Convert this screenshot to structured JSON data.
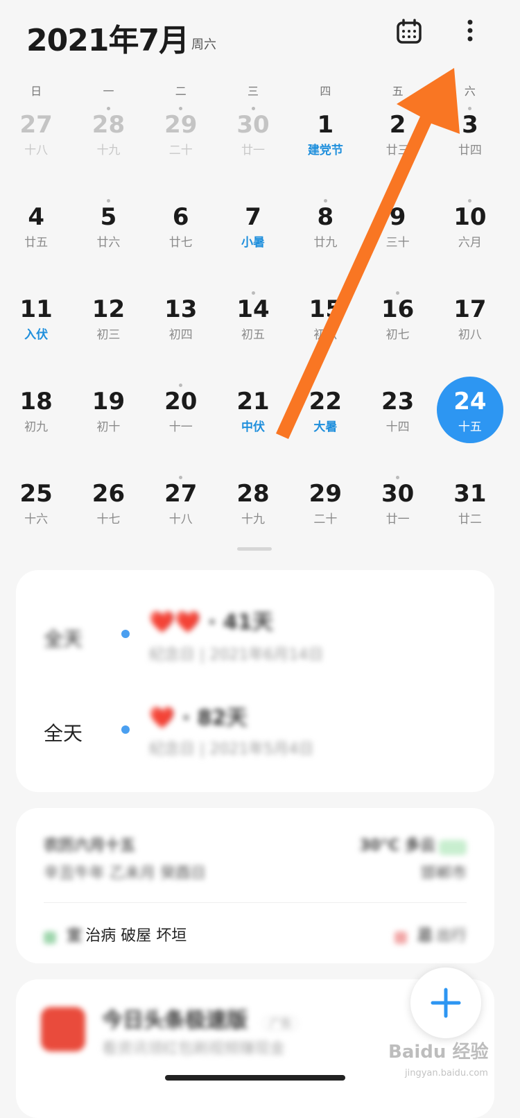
{
  "header": {
    "title": "2021年7月",
    "weekday": "周六"
  },
  "weekdays": [
    "日",
    "一",
    "二",
    "三",
    "四",
    "五",
    "六"
  ],
  "weeks": [
    [
      {
        "num": "27",
        "lunar": "十八",
        "other": true,
        "dot": false
      },
      {
        "num": "28",
        "lunar": "十九",
        "other": true,
        "dot": true
      },
      {
        "num": "29",
        "lunar": "二十",
        "other": true,
        "dot": true
      },
      {
        "num": "30",
        "lunar": "廿一",
        "other": true,
        "dot": true
      },
      {
        "num": "1",
        "lunar": "建党节",
        "highlight": true,
        "dot": false
      },
      {
        "num": "2",
        "lunar": "廿三",
        "dot": false
      },
      {
        "num": "3",
        "lunar": "廿四",
        "dot": true
      }
    ],
    [
      {
        "num": "4",
        "lunar": "廿五",
        "dot": false
      },
      {
        "num": "5",
        "lunar": "廿六",
        "dot": true
      },
      {
        "num": "6",
        "lunar": "廿七",
        "dot": false
      },
      {
        "num": "7",
        "lunar": "小暑",
        "highlight": true,
        "dot": false
      },
      {
        "num": "8",
        "lunar": "廿九",
        "dot": true
      },
      {
        "num": "9",
        "lunar": "三十",
        "dot": false
      },
      {
        "num": "10",
        "lunar": "六月",
        "dot": true
      }
    ],
    [
      {
        "num": "11",
        "lunar": "入伏",
        "highlight": true,
        "dot": false
      },
      {
        "num": "12",
        "lunar": "初三",
        "dot": false
      },
      {
        "num": "13",
        "lunar": "初四",
        "dot": false
      },
      {
        "num": "14",
        "lunar": "初五",
        "dot": true
      },
      {
        "num": "15",
        "lunar": "初六",
        "dot": false
      },
      {
        "num": "16",
        "lunar": "初七",
        "dot": true
      },
      {
        "num": "17",
        "lunar": "初八",
        "dot": false
      }
    ],
    [
      {
        "num": "18",
        "lunar": "初九",
        "dot": false
      },
      {
        "num": "19",
        "lunar": "初十",
        "dot": false
      },
      {
        "num": "20",
        "lunar": "十一",
        "dot": true
      },
      {
        "num": "21",
        "lunar": "中伏",
        "highlight": true,
        "dot": false
      },
      {
        "num": "22",
        "lunar": "大暑",
        "highlight": true,
        "dot": false
      },
      {
        "num": "23",
        "lunar": "十四",
        "dot": false
      },
      {
        "num": "24",
        "lunar": "十五",
        "today": true,
        "dot": false
      }
    ],
    [
      {
        "num": "25",
        "lunar": "十六",
        "dot": false
      },
      {
        "num": "26",
        "lunar": "十七",
        "dot": false
      },
      {
        "num": "27",
        "lunar": "十八",
        "dot": true
      },
      {
        "num": "28",
        "lunar": "十九",
        "dot": false
      },
      {
        "num": "29",
        "lunar": "二十",
        "dot": false
      },
      {
        "num": "30",
        "lunar": "廿一",
        "dot": true
      },
      {
        "num": "31",
        "lunar": "廿二",
        "dot": false
      }
    ]
  ],
  "events": [
    {
      "time": "全天",
      "title": "❤️❤️ · 41天",
      "sub": "纪念日 | 2021年6月14日"
    },
    {
      "time": "全天",
      "title": "❤️ · 82天",
      "sub": "纪念日 | 2021年5月4日"
    }
  ],
  "lunar_card": {
    "title": "农历六月十五",
    "ganzhi": "辛丑牛年 乙未月 癸酉日",
    "weather": "30°C 多云",
    "weather_extra": "邯郸市",
    "yi_label": "宜",
    "yi_text": "治病 破屋 坏垣",
    "ji_label": "忌",
    "ji_text": "出行"
  },
  "ad_card": {
    "app_name": "今日头条极速版",
    "tag": "广告",
    "sub": "看资讯领红包刷视频赚现金"
  },
  "watermark": "Baidu 经验",
  "watermark_sub": "jingyan.baidu.com"
}
